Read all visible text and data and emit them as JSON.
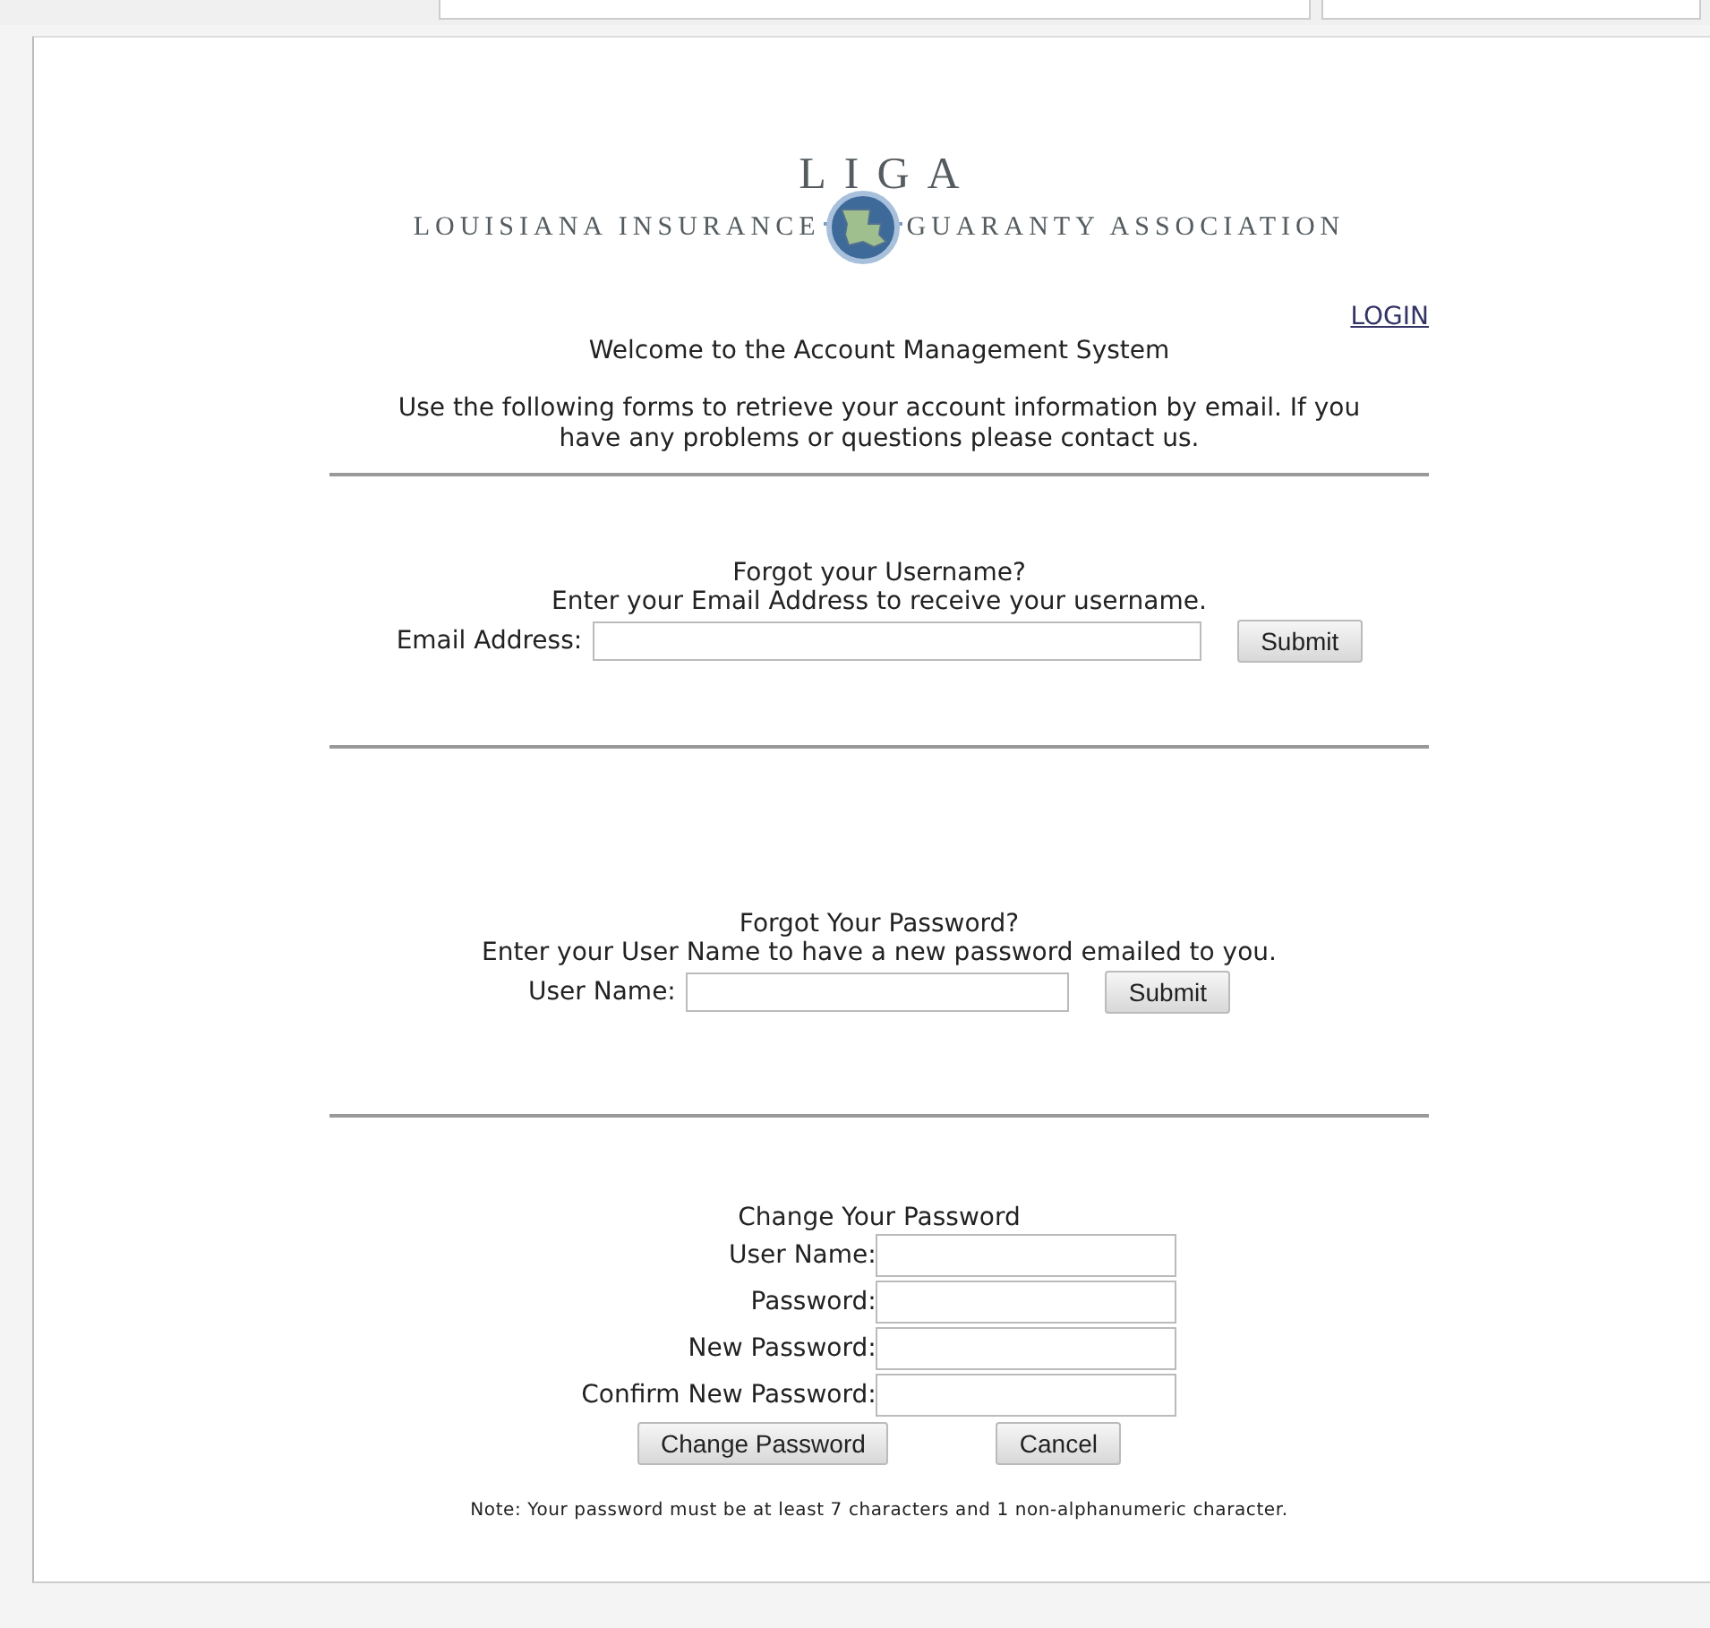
{
  "logo": {
    "title": "LIGA",
    "name_left": "LOUISIANA INSURANCE",
    "name_right": "GUARANTY ASSOCIATION"
  },
  "login_link": "LOGIN",
  "welcome": "Welcome to the Account Management System",
  "intro": "Use the following forms to retrieve your account information by email. If you have any problems or questions please contact us.",
  "sections": [
    {
      "kind": "single",
      "title": "Forgot your Username?",
      "description": "Enter your Email Address to receive your username.",
      "fields": [
        {
          "label": "Email Address:"
        }
      ],
      "buttons": [
        "Submit"
      ]
    },
    {
      "kind": "single",
      "title": "Forgot Your Password?",
      "description": "Enter your User Name to have a new password emailed to you.",
      "fields": [
        {
          "label": "User Name:"
        }
      ],
      "buttons": [
        "Submit"
      ]
    },
    {
      "kind": "form",
      "title": "Change Your Password",
      "fields": [
        {
          "label": "User Name:"
        },
        {
          "label": "Password:"
        },
        {
          "label": "New Password:"
        },
        {
          "label": "Confirm New Password:"
        }
      ],
      "buttons": [
        "Change Password",
        "Cancel"
      ]
    }
  ],
  "note": "Note: Your password must be at least 7 characters and 1 non-alphanumeric character."
}
